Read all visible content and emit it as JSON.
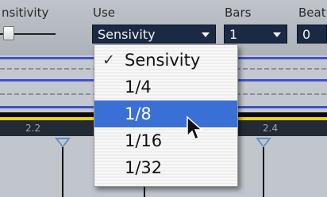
{
  "toolbar": {
    "sensitivity_label": "nsitivity",
    "use_label": "Use",
    "use_value": "Sensivity",
    "bars_label": "Bars",
    "bars_value": "1",
    "beats_label": "Beat",
    "beats_value": "0"
  },
  "ruler": {
    "marks": [
      "2.2",
      "2.4"
    ]
  },
  "menu": {
    "items": [
      {
        "label": "Sensivity",
        "checked": true,
        "highlighted": false
      },
      {
        "label": "1/4",
        "checked": false,
        "highlighted": false
      },
      {
        "label": "1/8",
        "checked": false,
        "highlighted": true
      },
      {
        "label": "1/16",
        "checked": false,
        "highlighted": false
      },
      {
        "label": "1/32",
        "checked": false,
        "highlighted": false
      }
    ],
    "check_glyph": "✓"
  },
  "colors": {
    "selection": "#3a6fd6",
    "lane_line": "#3e52c8",
    "ruler_band": "#f0d400",
    "dropdown_bg": "#1a2a44"
  }
}
